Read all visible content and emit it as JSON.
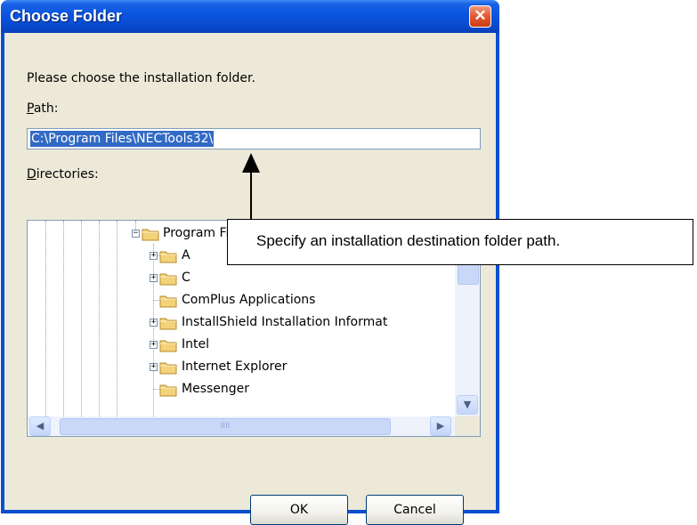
{
  "window": {
    "title": "Choose Folder",
    "close_glyph": "✕"
  },
  "dialog": {
    "prompt": "Please choose the installation folder.",
    "path_label_accel": "P",
    "path_label_rest": "ath:",
    "path_value": "C:\\Program Files\\NECTools32\\",
    "dirs_label_accel": "D",
    "dirs_label_rest": "irectories:"
  },
  "tree": {
    "items": [
      {
        "label": "Program Files",
        "expander": "minus"
      },
      {
        "label": "A",
        "expander": "plus"
      },
      {
        "label": "C",
        "expander": "plus"
      },
      {
        "label": "ComPlus Applications",
        "expander": "none"
      },
      {
        "label": "InstallShield Installation Informat",
        "expander": "plus"
      },
      {
        "label": "Intel",
        "expander": "plus"
      },
      {
        "label": "Internet Explorer",
        "expander": "plus"
      },
      {
        "label": "Messenger",
        "expander": "none"
      }
    ],
    "scroll_up_glyph": "▲",
    "scroll_down_glyph": "▼",
    "scroll_left_glyph": "◀",
    "scroll_right_glyph": "▶",
    "hthumb_grip": "IIII"
  },
  "buttons": {
    "ok": "OK",
    "cancel": "Cancel"
  },
  "annotation": {
    "text": "Specify an installation destination folder path."
  },
  "colors": {
    "titlebar": "#0a55e0",
    "selection": "#316ac5",
    "folder": "#f3d27a"
  }
}
